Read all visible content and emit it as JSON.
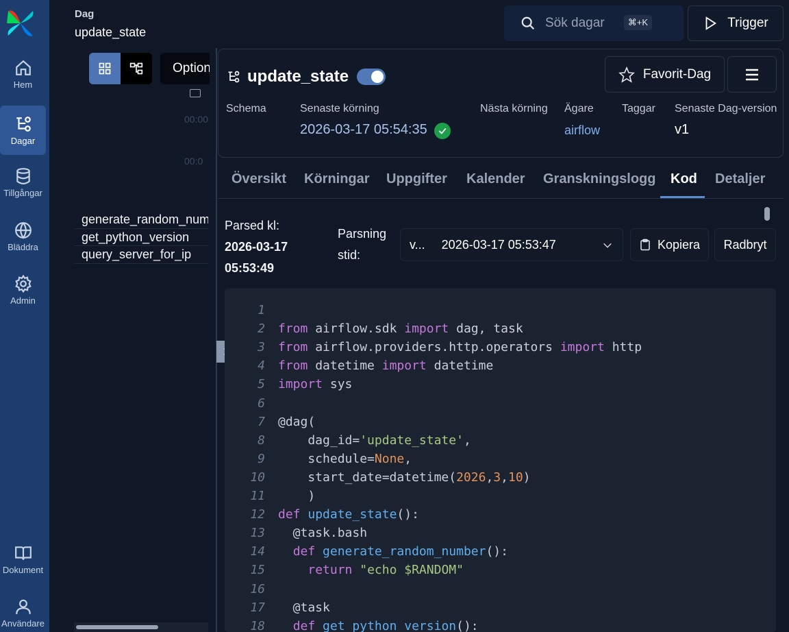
{
  "nav": {
    "items": [
      {
        "label": "Hem",
        "icon": "home-icon"
      },
      {
        "label": "Dagar",
        "icon": "dag-icon"
      },
      {
        "label": "Tillgångar",
        "icon": "database-icon"
      },
      {
        "label": "Bläddra",
        "icon": "globe-icon"
      },
      {
        "label": "Admin",
        "icon": "gear-icon"
      },
      {
        "label": "Dokument",
        "icon": "book-icon"
      },
      {
        "label": "Användare",
        "icon": "user-icon"
      }
    ],
    "active": "Dagar"
  },
  "header": {
    "crumb_label": "Dag",
    "crumb_value": "update_state",
    "search_placeholder": "Sök dagar",
    "search_shortcut": "⌘+K",
    "trigger_label": "Trigger"
  },
  "left_panel": {
    "options_label": "Options",
    "time_ticks": [
      "00:00",
      "00:0"
    ],
    "tasks": [
      "generate_random_number",
      "get_python_version",
      "query_server_for_ip"
    ]
  },
  "dag": {
    "title": "update_state",
    "paused": false,
    "favorite_label": "Favorit-Dag",
    "meta": {
      "schedule_label": "Schema",
      "last_run_label": "Senaste körning",
      "last_run_value": "2026-03-17 05:54:35",
      "next_run_label": "Nästa körning",
      "owner_label": "Ägare",
      "owner_value": "airflow",
      "tags_label": "Taggar",
      "version_label": "Senaste Dag-version",
      "version_value": "v1"
    }
  },
  "tabs": [
    "Översikt",
    "Körningar",
    "Uppgifter",
    "Kalender",
    "Granskningslogg",
    "Kod",
    "Detaljer"
  ],
  "active_tab": "Kod",
  "code_toolbar": {
    "parsed_label": "Parsed kl:",
    "parsed_date": "2026-03-17",
    "parsed_time": "05:53:49",
    "parsing_label_1": "Parsning",
    "parsing_label_2": "stid:",
    "version_short": "v...",
    "version_date": "2026-03-17 05:53:47",
    "copy_label": "Kopiera",
    "wrap_label": "Radbryt"
  },
  "code_lines": [
    "",
    "from airflow.sdk import dag, task",
    "from airflow.providers.http.operators import http",
    "from datetime import datetime",
    "import sys",
    "",
    "@dag(",
    "    dag_id='update_state',",
    "    schedule=None,",
    "    start_date=datetime(2026,3,10)",
    "    )",
    "def update_state():",
    "  @task.bash",
    "  def generate_random_number():",
    "    return \"echo $RANDOM\"",
    "",
    "  @task",
    "  def get_python_version():"
  ],
  "colors": {
    "nav_bg": "#1c3d6e",
    "accent": "#5a8bd0",
    "success": "#1e9e4a",
    "keyword": "#c678dd",
    "function": "#61afef",
    "string": "#a8c983",
    "number": "#e5935b"
  }
}
